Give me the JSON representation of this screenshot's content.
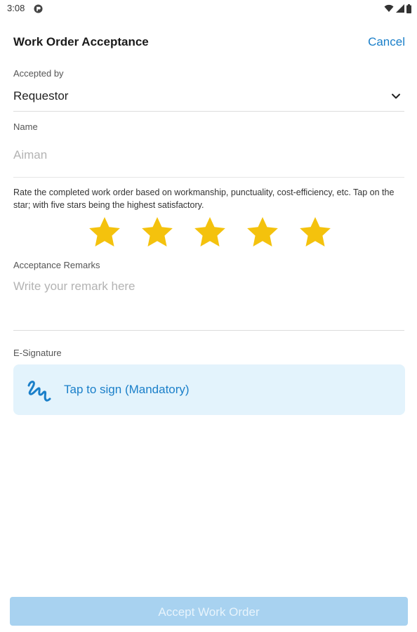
{
  "status_bar": {
    "time": "3:08"
  },
  "header": {
    "title": "Work Order Acceptance",
    "cancel_label": "Cancel"
  },
  "accepted_by": {
    "label": "Accepted by",
    "value": "Requestor"
  },
  "name": {
    "label": "Name",
    "value": "Aiman"
  },
  "rating": {
    "hint": "Rate the completed work order based on workmanship, punctuality, cost-efficiency, etc. Tap on the star; with five stars being the highest satisfactory.",
    "value": 5,
    "max": 5,
    "star_color": "#f4c20d"
  },
  "remarks": {
    "label": "Acceptance Remarks",
    "placeholder": "Write your remark here"
  },
  "signature": {
    "label": "E-Signature",
    "button_label": "Tap to sign (Mandatory)",
    "icon": "signature-icon"
  },
  "footer": {
    "accept_label": "Accept Work Order"
  },
  "colors": {
    "accent": "#1a7fc9",
    "sign_box_bg": "#e3f3fc",
    "button_disabled_bg": "#a8d2f0"
  }
}
